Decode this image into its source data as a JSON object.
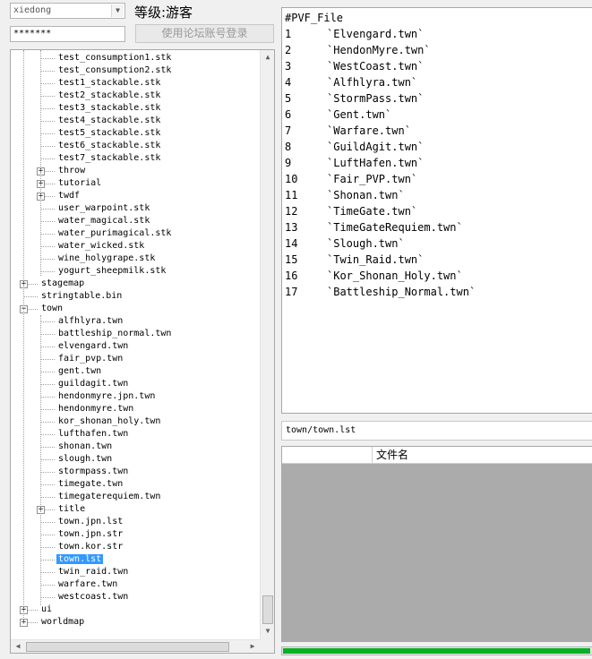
{
  "login": {
    "username": "xiedong",
    "level_label": "等级:游客",
    "password_mask": "*******",
    "forum_login_button": "使用论坛账号登录"
  },
  "tree": {
    "items": [
      {
        "label": "test_consumption1.stk",
        "depth": 2
      },
      {
        "label": "test_consumption2.stk",
        "depth": 2
      },
      {
        "label": "test1_stackable.stk",
        "depth": 2
      },
      {
        "label": "test2_stackable.stk",
        "depth": 2
      },
      {
        "label": "test3_stackable.stk",
        "depth": 2
      },
      {
        "label": "test4_stackable.stk",
        "depth": 2
      },
      {
        "label": "test5_stackable.stk",
        "depth": 2
      },
      {
        "label": "test6_stackable.stk",
        "depth": 2
      },
      {
        "label": "test7_stackable.stk",
        "depth": 2
      },
      {
        "label": "throw",
        "depth": 2,
        "expander": "+"
      },
      {
        "label": "tutorial",
        "depth": 2,
        "expander": "+"
      },
      {
        "label": "twdf",
        "depth": 2,
        "expander": "+"
      },
      {
        "label": "user_warpoint.stk",
        "depth": 2
      },
      {
        "label": "water_magical.stk",
        "depth": 2
      },
      {
        "label": "water_purimagical.stk",
        "depth": 2
      },
      {
        "label": "water_wicked.stk",
        "depth": 2
      },
      {
        "label": "wine_holygrape.stk",
        "depth": 2
      },
      {
        "label": "yogurt_sheepmilk.stk",
        "depth": 2
      },
      {
        "label": "stagemap",
        "depth": 1,
        "expander": "+"
      },
      {
        "label": "stringtable.bin",
        "depth": 1
      },
      {
        "label": "town",
        "depth": 1,
        "expander": "-"
      },
      {
        "label": "alfhlyra.twn",
        "depth": 2
      },
      {
        "label": "battleship_normal.twn",
        "depth": 2
      },
      {
        "label": "elvengard.twn",
        "depth": 2
      },
      {
        "label": "fair_pvp.twn",
        "depth": 2
      },
      {
        "label": "gent.twn",
        "depth": 2
      },
      {
        "label": "guildagit.twn",
        "depth": 2
      },
      {
        "label": "hendonmyre.jpn.twn",
        "depth": 2
      },
      {
        "label": "hendonmyre.twn",
        "depth": 2
      },
      {
        "label": "kor_shonan_holy.twn",
        "depth": 2
      },
      {
        "label": "lufthafen.twn",
        "depth": 2
      },
      {
        "label": "shonan.twn",
        "depth": 2
      },
      {
        "label": "slough.twn",
        "depth": 2
      },
      {
        "label": "stormpass.twn",
        "depth": 2
      },
      {
        "label": "timegate.twn",
        "depth": 2
      },
      {
        "label": "timegaterequiem.twn",
        "depth": 2
      },
      {
        "label": "title",
        "depth": 2,
        "expander": "+"
      },
      {
        "label": "town.jpn.lst",
        "depth": 2
      },
      {
        "label": "town.jpn.str",
        "depth": 2
      },
      {
        "label": "town.kor.str",
        "depth": 2
      },
      {
        "label": "town.lst",
        "depth": 2,
        "selected": true
      },
      {
        "label": "twin_raid.twn",
        "depth": 2
      },
      {
        "label": "warfare.twn",
        "depth": 2
      },
      {
        "label": "westcoast.twn",
        "depth": 2
      },
      {
        "label": "ui",
        "depth": 1,
        "expander": "+"
      },
      {
        "label": "worldmap",
        "depth": 1,
        "expander": "+"
      }
    ]
  },
  "content": {
    "header": "#PVF_File",
    "lines": [
      {
        "num": "1",
        "text": "`Elvengard.twn`"
      },
      {
        "num": "2",
        "text": "`HendonMyre.twn`"
      },
      {
        "num": "3",
        "text": "`WestCoast.twn`"
      },
      {
        "num": "4",
        "text": "`Alfhlyra.twn`"
      },
      {
        "num": "5",
        "text": "`StormPass.twn`"
      },
      {
        "num": "6",
        "text": "`Gent.twn`"
      },
      {
        "num": "7",
        "text": "`Warfare.twn`"
      },
      {
        "num": "8",
        "text": "`GuildAgit.twn`"
      },
      {
        "num": "9",
        "text": "`LuftHafen.twn`"
      },
      {
        "num": "10",
        "text": "`Fair_PVP.twn`"
      },
      {
        "num": "11",
        "text": "`Shonan.twn`"
      },
      {
        "num": "12",
        "text": "`TimeGate.twn`"
      },
      {
        "num": "13",
        "text": "`TimeGateRequiem.twn`"
      },
      {
        "num": "14",
        "text": "`Slough.twn`"
      },
      {
        "num": "15",
        "text": "`Twin_Raid.twn`"
      },
      {
        "num": "16",
        "text": "`Kor_Shonan_Holy.twn`"
      },
      {
        "num": "17",
        "text": "`Battleship_Normal.twn`"
      }
    ]
  },
  "path_bar": "town/town.lst",
  "file_list": {
    "columns": [
      "",
      "文件名"
    ]
  },
  "progress": {
    "fraction": 1.0
  },
  "icons": {
    "dropdown": "chevron-down-icon",
    "expand": "plus-box-icon",
    "collapse": "minus-box-icon"
  }
}
